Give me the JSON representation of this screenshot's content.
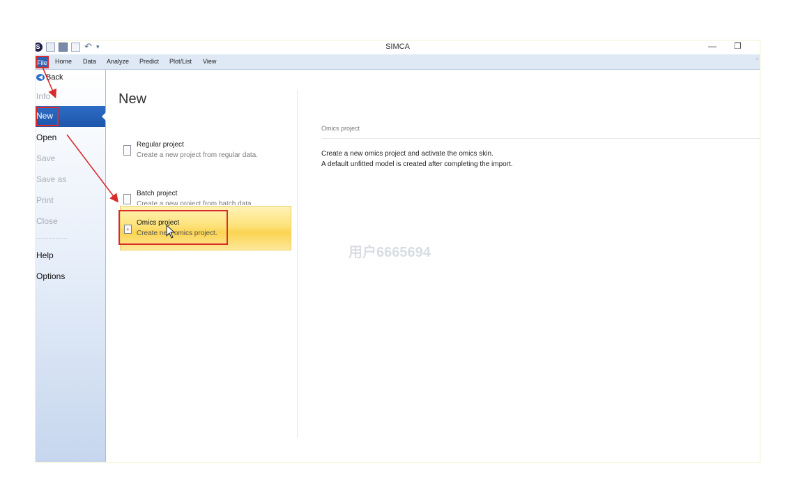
{
  "window": {
    "title": "SIMCA",
    "logo_glyph": "S",
    "undo_glyph": "↶",
    "dropdown_glyph": "▾",
    "minimize_glyph": "—",
    "restore_glyph": "❐"
  },
  "menubar": {
    "file": "File",
    "tabs": [
      "Home",
      "Data",
      "Analyze",
      "Predict",
      "Plot/List",
      "View"
    ],
    "collapse_glyph": "^"
  },
  "sidebar": {
    "back": "Back",
    "items": [
      {
        "label": "Info",
        "enabled": false
      },
      {
        "label": "New",
        "selected": true
      },
      {
        "label": "Open",
        "enabled": true
      },
      {
        "label": "Save",
        "enabled": false
      },
      {
        "label": "Save as",
        "enabled": false
      },
      {
        "label": "Print",
        "enabled": false
      },
      {
        "label": "Close",
        "enabled": false
      },
      {
        "label": "Help",
        "enabled": true
      },
      {
        "label": "Options",
        "enabled": true
      }
    ]
  },
  "main": {
    "heading": "New",
    "options": [
      {
        "title": "Regular project",
        "desc": "Create a new project from regular data."
      },
      {
        "title": "Batch project",
        "desc": "Create a new project from batch data."
      },
      {
        "title": "Omics project",
        "desc": "Create new omics project.",
        "selected": true
      }
    ],
    "detail": {
      "title": "Omics project",
      "desc_line1": "Create a new omics project and activate the omics skin.",
      "desc_line2": "A default unfitted model is created after completing the import."
    }
  },
  "watermark": "用户6665694",
  "colors": {
    "selected_nav": "#2b62b5",
    "highlight": "#fbd452",
    "annotation_red": "#d82c2c"
  }
}
